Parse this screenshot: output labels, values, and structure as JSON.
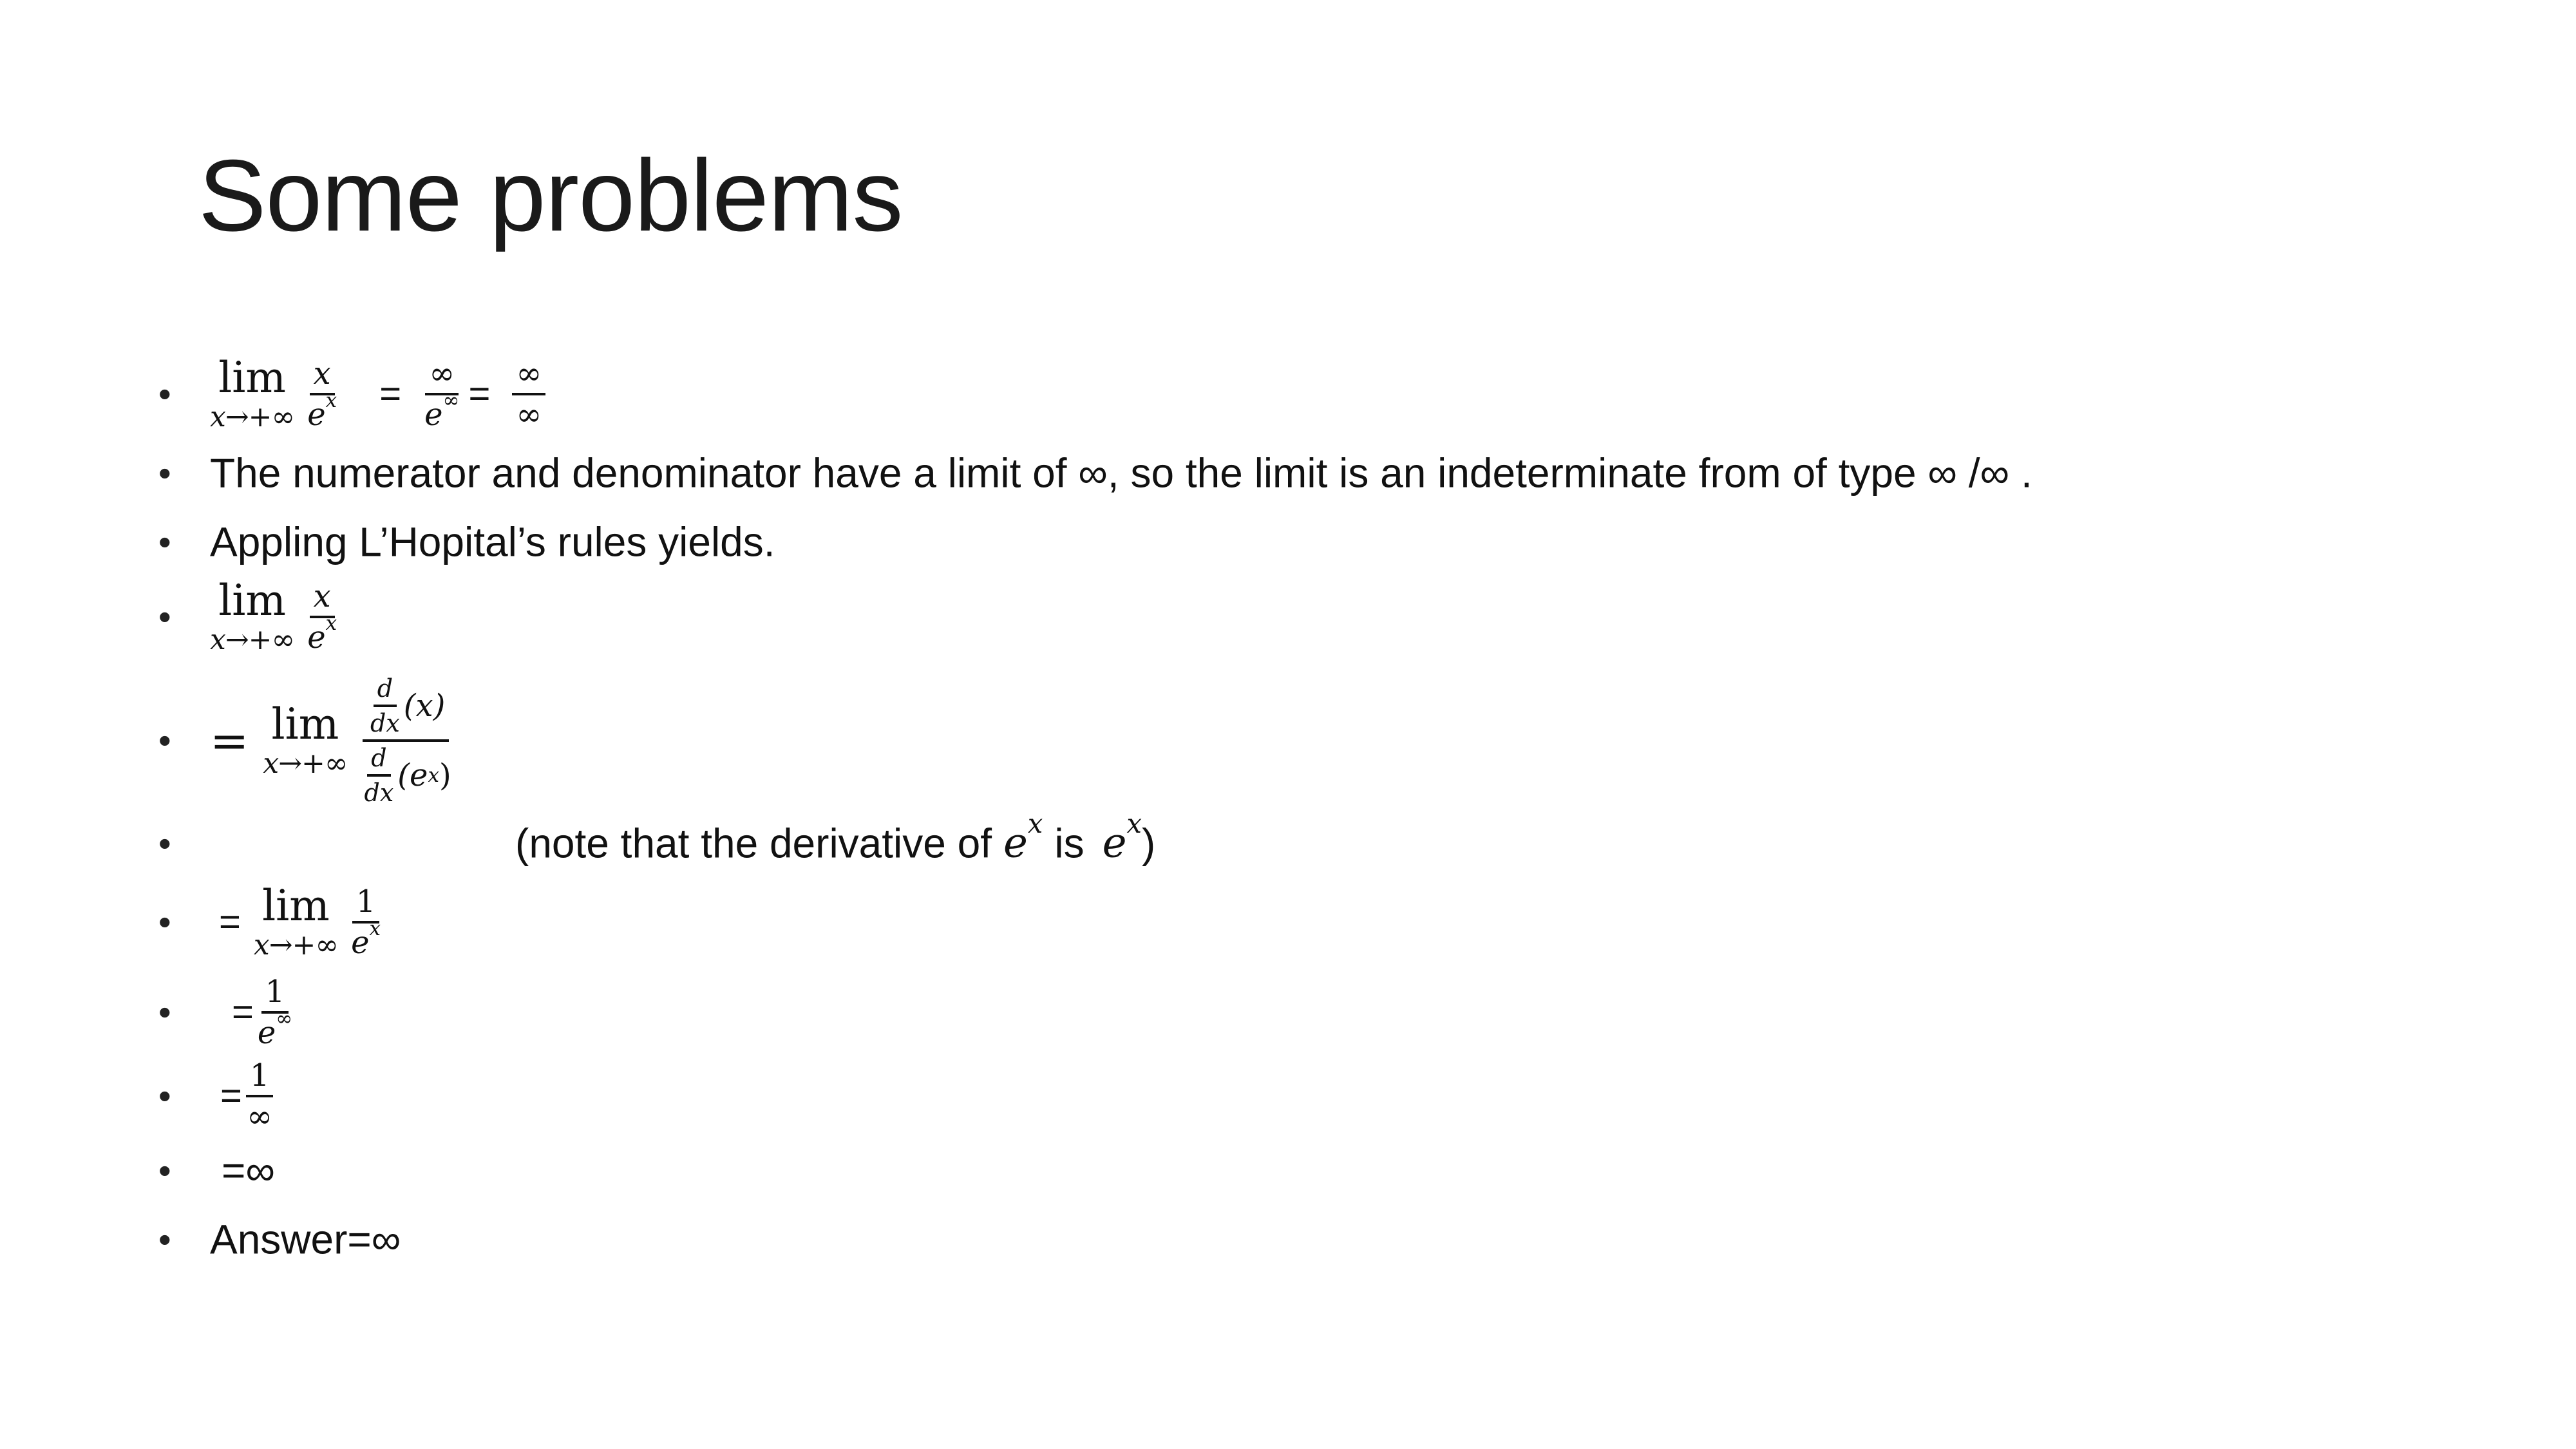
{
  "slide": {
    "title": "Some problems",
    "symbols": {
      "lim": "lim",
      "lim_sub": "x→+∞",
      "x": "x",
      "e": "e",
      "inf": "∞",
      "one": "1",
      "eq": "=",
      "d": "d",
      "dx": "dx",
      "paren_x": "(x)",
      "paren_ex_open": "(e",
      "paren_close": ")"
    },
    "lines": {
      "numerator_denominator": "The numerator and denominator have a limit of ∞, so the limit is an indeterminate from of type  ∞ /∞ .",
      "appling": "Appling L’Hopital’s rules yields.",
      "note_prefix": "(note that  the derivative of",
      "note_is": "is",
      "note_close": ")",
      "eq_inf": "=∞",
      "answer": "Answer=∞"
    }
  }
}
